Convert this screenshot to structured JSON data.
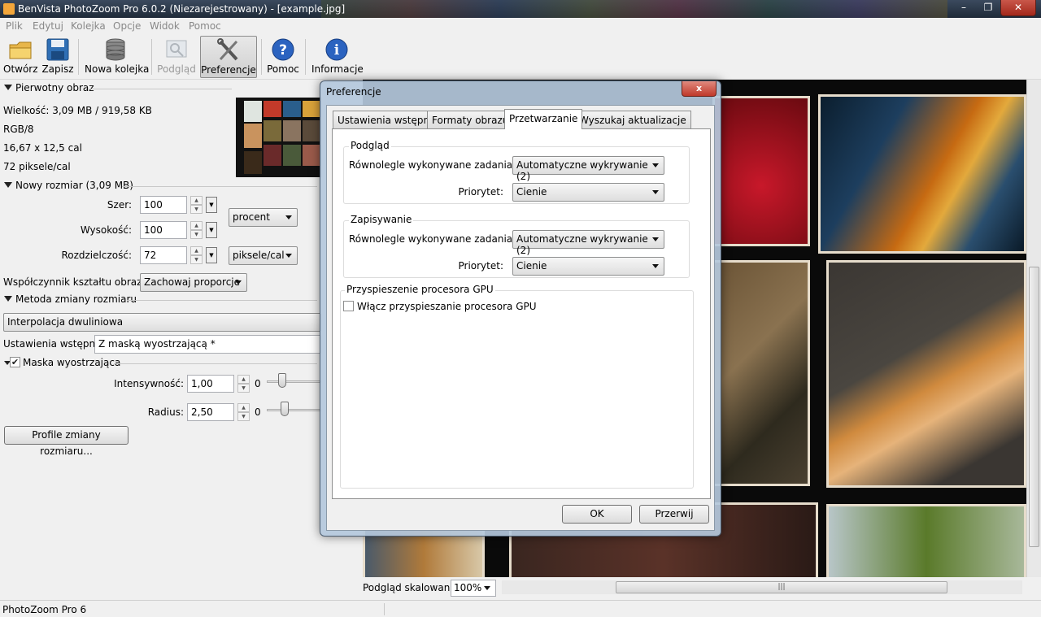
{
  "window": {
    "title": "BenVista PhotoZoom Pro 6.0.2 (Niezarejestrowany) - [example.jpg]",
    "controls": [
      "–",
      "❐",
      "✕"
    ]
  },
  "menu": [
    "Plik",
    "Edytuj",
    "Kolejka",
    "Opcje",
    "Widok",
    "Pomoc"
  ],
  "toolbar": {
    "open": "Otwórz",
    "save": "Zapisz",
    "new_queue": "Nowa kolejka",
    "preview": "Podgląd",
    "preferences": "Preferencje",
    "help": "Pomoc",
    "info": "Informacje"
  },
  "original": {
    "header": "Pierwotny obraz",
    "size": "Wielkość: 3,09 MB / 919,58 KB",
    "mode": "RGB/8",
    "dimensions": "16,67 x 12,5 cal",
    "resolution": "72 piksele/cal"
  },
  "newsize": {
    "header": "Nowy rozmiar (3,09 MB)",
    "width_label": "Szer:",
    "width_value": "100",
    "height_label": "Wysokość:",
    "height_value": "100",
    "res_label": "Rozdzielczość:",
    "res_value": "72",
    "unit_size": "procent",
    "unit_res": "piksele/cal",
    "aspect_label": "Współczynnik kształtu obrazu:",
    "aspect_value": "Zachowaj proporcje"
  },
  "method": {
    "header": "Metoda zmiany rozmiaru",
    "value": "Interpolacja dwuliniowa",
    "preset_label": "Ustawienia wstępne:",
    "preset_value": "Z maską wyostrzającą *",
    "mask_label": "Maska wyostrzająca",
    "mask_checked": true,
    "intensity_label": "Intensywność:",
    "intensity_value": "1,00",
    "intensity_min": "0",
    "radius_label": "Radius:",
    "radius_value": "2,50",
    "radius_min": "0",
    "profiles_button": "Profile zmiany rozmiaru..."
  },
  "preview_bar": {
    "label": "Podgląd skalowania",
    "zoom": "100%"
  },
  "status": "PhotoZoom Pro 6",
  "dialog": {
    "title": "Preferencje",
    "close": "x",
    "tabs": [
      "Ustawienia wstępne",
      "Formaty obrazu",
      "Przetwarzanie",
      "Wyszukaj aktualizacje"
    ],
    "selected_tab": "Przetwarzanie",
    "preview_group": {
      "title": "Podgląd",
      "parallel_label": "Równolegle wykonywane zadania:",
      "parallel_value": "Automatyczne wykrywanie (2)",
      "priority_label": "Priorytet:",
      "priority_value": "Cienie"
    },
    "save_group": {
      "title": "Zapisywanie",
      "parallel_label": "Równolegle wykonywane zadania:",
      "parallel_value": "Automatyczne wykrywanie (2)",
      "priority_label": "Priorytet:",
      "priority_value": "Cienie"
    },
    "gpu_group": {
      "title": "Przyspieszenie procesora GPU",
      "checkbox_label": "Włącz przyspieszanie procesora GPU",
      "checked": false
    },
    "ok": "OK",
    "cancel": "Przerwij"
  },
  "colors": {
    "titlebar": "#1f2a38",
    "accent_selected": "#cfcfcf",
    "dialog_frame": "#b4c8dc"
  }
}
